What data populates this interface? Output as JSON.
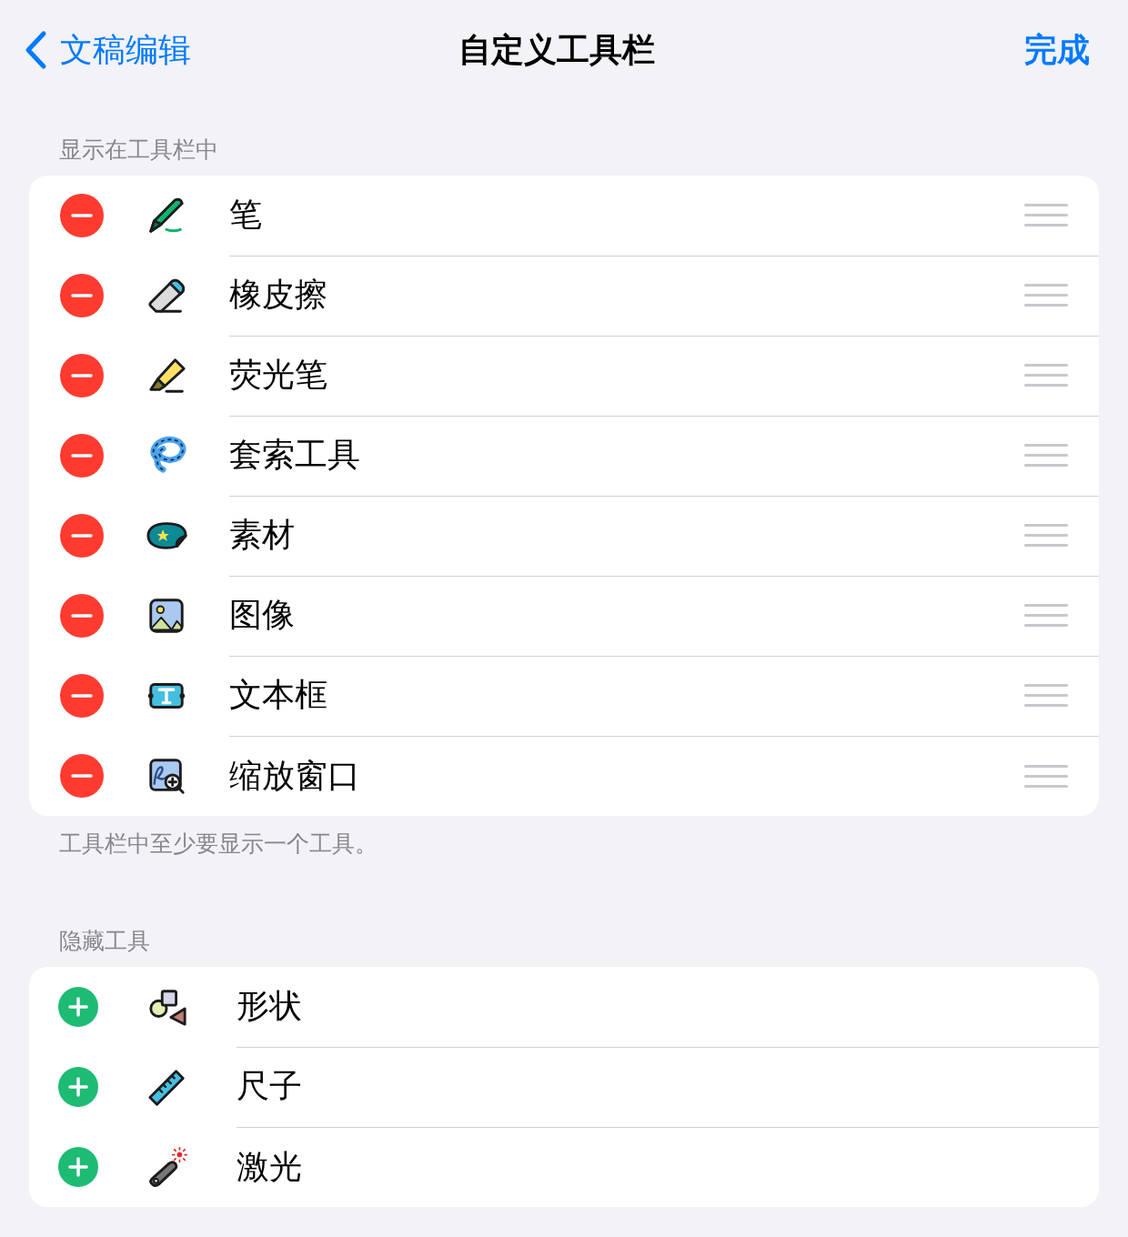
{
  "nav": {
    "back_label": "文稿编辑",
    "title": "自定义工具栏",
    "done_label": "完成"
  },
  "shown_section": {
    "header": "显示在工具栏中",
    "footer": "工具栏中至少要显示一个工具。",
    "items": [
      {
        "label": "笔",
        "kind": "pen"
      },
      {
        "label": "橡皮擦",
        "kind": "eraser"
      },
      {
        "label": "荧光笔",
        "kind": "highlighter"
      },
      {
        "label": "套索工具",
        "kind": "lasso"
      },
      {
        "label": "素材",
        "kind": "sticker"
      },
      {
        "label": "图像",
        "kind": "image"
      },
      {
        "label": "文本框",
        "kind": "textbox"
      },
      {
        "label": "缩放窗口",
        "kind": "zoom"
      }
    ]
  },
  "hidden_section": {
    "header": "隐藏工具",
    "items": [
      {
        "label": "形状",
        "kind": "shapes"
      },
      {
        "label": "尺子",
        "kind": "ruler"
      },
      {
        "label": "激光",
        "kind": "laser"
      }
    ]
  }
}
